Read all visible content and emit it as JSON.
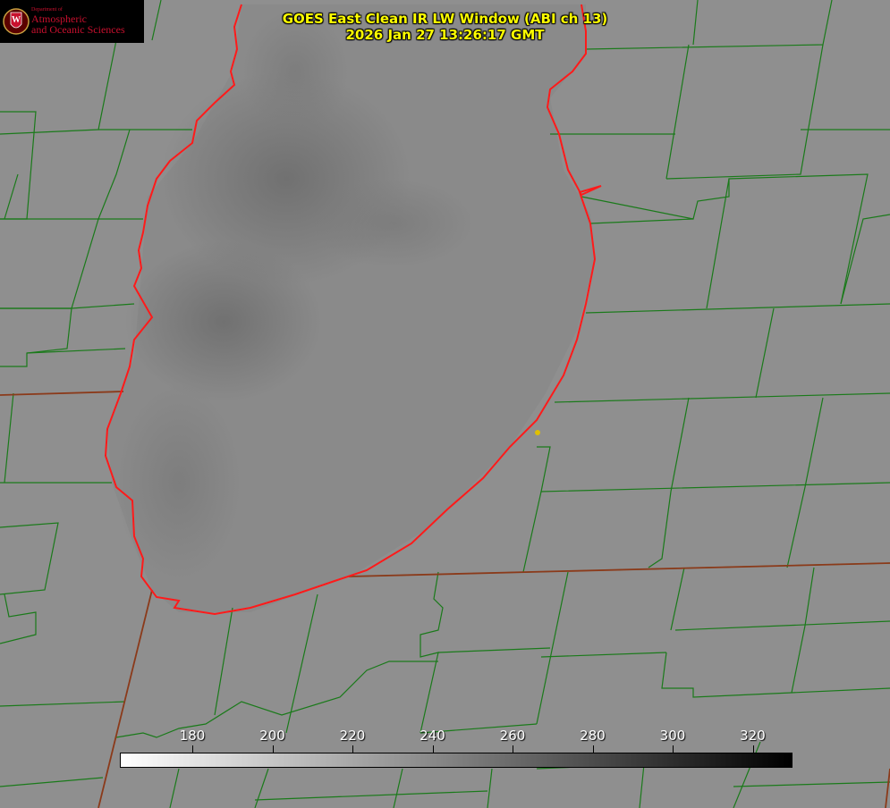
{
  "title": {
    "line1": "GOES East Clean IR LW Window (ABI ch 13)",
    "line2": "2026 Jan 27 13:26:17 GMT"
  },
  "logo": {
    "dept": "Department of",
    "line1": "Atmospheric",
    "line2": "and Oceanic Sciences",
    "seal_letter": "W"
  },
  "colorbar": {
    "ticks": [
      "180",
      "200",
      "220",
      "240",
      "260",
      "280",
      "300",
      "320"
    ],
    "gradient_from": "#ffffff",
    "gradient_to": "#000000"
  },
  "colors": {
    "background": "#8f8f8f",
    "county_lines": "#1a7a1a",
    "lake_outline": "#ff1a1a",
    "state_lines": "#8b3a1a",
    "title": "#ffff00",
    "logo_red": "#c8102e",
    "marker": "#e0c000"
  }
}
